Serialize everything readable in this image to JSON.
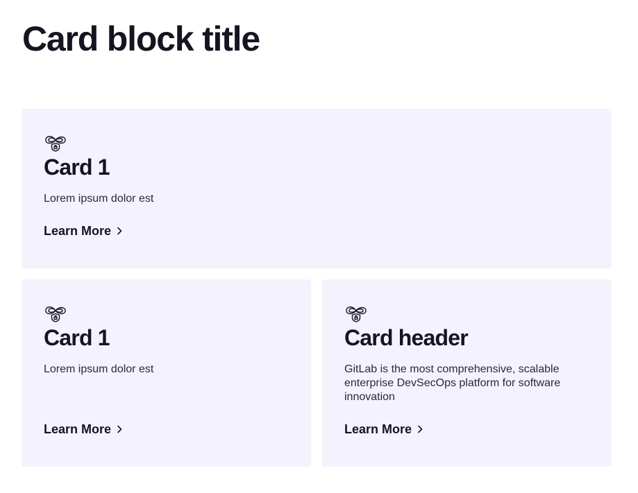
{
  "page": {
    "title": "Card block title"
  },
  "cards": [
    {
      "icon": "infinity-lock-icon",
      "title": "Card 1",
      "text": "Lorem ipsum dolor est",
      "link_label": "Learn More"
    },
    {
      "icon": "infinity-lock-icon",
      "title": "Card 1",
      "text": "Lorem ipsum dolor est",
      "link_label": "Learn More"
    },
    {
      "icon": "infinity-lock-icon",
      "title": "Card header",
      "text": "GitLab is the most comprehensive, scalable enterprise DevSecOps platform for software innovation",
      "link_label": "Learn More"
    }
  ],
  "colors": {
    "card_background": "#f4f2fd",
    "text_primary": "#171321",
    "text_body": "#2b2838"
  }
}
